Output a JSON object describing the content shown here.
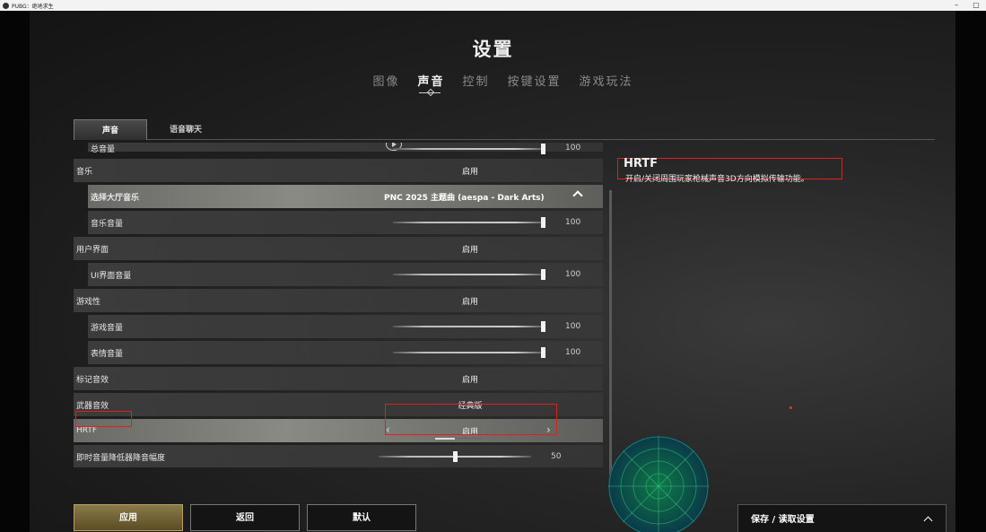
{
  "window": {
    "title": "PUBG：绝地求生",
    "minimize_glyph": "–",
    "maximize_glyph": "▢"
  },
  "header": {
    "title": "设置",
    "tabs": [
      {
        "label": "图像",
        "active": false
      },
      {
        "label": "声音",
        "active": true
      },
      {
        "label": "控制",
        "active": false
      },
      {
        "label": "按键设置",
        "active": false
      },
      {
        "label": "游戏玩法",
        "active": false
      }
    ]
  },
  "subtabs": [
    {
      "label": "声音",
      "active": true
    },
    {
      "label": "语音聊天",
      "active": false
    }
  ],
  "settings": {
    "partial_top": {
      "label": "总音量",
      "value": "100"
    },
    "music": {
      "label": "音乐",
      "value": "启用"
    },
    "lobby_music": {
      "label": "选择大厅音乐",
      "value": "PNC 2025 主题曲 (aespa - Dark Arts)"
    },
    "music_volume": {
      "label": "音乐音量",
      "value": "100",
      "level": 1.0
    },
    "ui": {
      "label": "用户界面",
      "value": "启用"
    },
    "ui_volume": {
      "label": "UI界面音量",
      "value": "100",
      "level": 1.0
    },
    "gameplay": {
      "label": "游戏性",
      "value": "启用"
    },
    "gameplay_volume": {
      "label": "游戏音量",
      "value": "100",
      "level": 1.0
    },
    "emote_volume": {
      "label": "表情音量",
      "value": "100",
      "level": 1.0
    },
    "marker_sfx": {
      "label": "标记音效",
      "value": "启用"
    },
    "weapon_sfx": {
      "label": "武器音效",
      "value": "经典版"
    },
    "hrtf": {
      "label": "HRTF",
      "value": "启用",
      "prev_glyph": "‹",
      "next_glyph": "›"
    },
    "noise_reduction": {
      "label": "即时音量降低器降音幅度",
      "value": "50",
      "level": 0.5
    }
  },
  "description": {
    "title": "HRTF",
    "text": "开启/关闭周围玩家枪械声音3D方向模拟传输功能。"
  },
  "buttons": {
    "apply": "应用",
    "back": "返回",
    "default": "默认",
    "save_load": "保存 / 读取设置"
  },
  "colors": {
    "highlight_red": "#e0201c",
    "apply_gold": "#8a7a4a",
    "radar_green": "#0e7a4a"
  }
}
